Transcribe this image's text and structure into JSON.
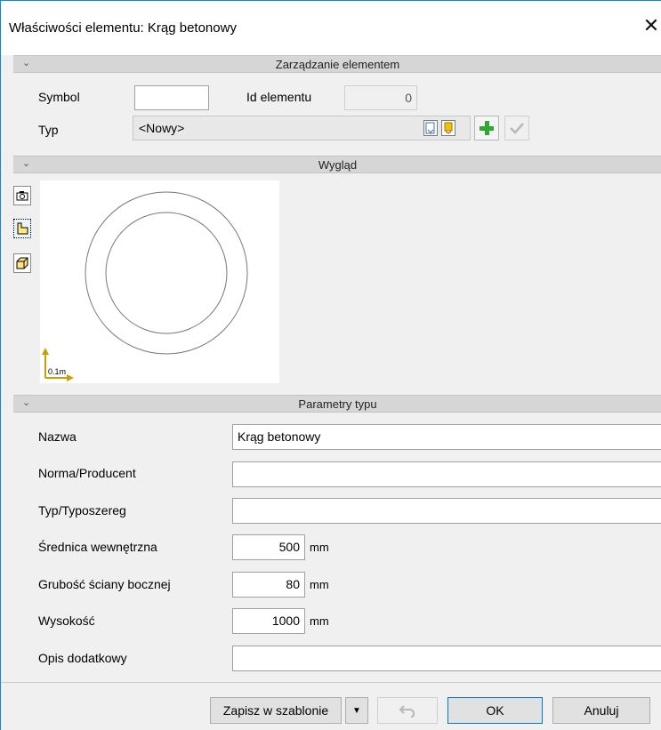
{
  "window": {
    "title": "Właściwości elementu: Krąg betonowy",
    "close_glyph": "✕"
  },
  "sections": {
    "management": {
      "label": "Zarządzanie elementem",
      "chevron": "⌄"
    },
    "appearance": {
      "label": "Wygląd",
      "chevron": "⌄"
    },
    "params": {
      "label": "Parametry typu",
      "chevron": "⌄"
    }
  },
  "management": {
    "symbol_label": "Symbol",
    "symbol_value": "",
    "id_label": "Id elementu",
    "id_value": "0",
    "typ_label": "Typ",
    "typ_value": "<Nowy>"
  },
  "preview": {
    "scale_label": "0.1m"
  },
  "params": {
    "nazwa_label": "Nazwa",
    "nazwa_value": "Krąg betonowy",
    "norma_label": "Norma/Producent",
    "norma_value": "",
    "typoszereg_label": "Typ/Typoszereg",
    "typoszereg_value": "",
    "srednica_label": "Średnica wewnętrzna",
    "srednica_value": "500",
    "srednica_unit": "mm",
    "grubosc_label": "Grubość ściany bocznej",
    "grubosc_value": "80",
    "grubosc_unit": "mm",
    "wysokosc_label": "Wysokość",
    "wysokosc_value": "1000",
    "wysokosc_unit": "mm",
    "opis_label": "Opis dodatkowy",
    "opis_value": ""
  },
  "footer": {
    "save_template_label": "Zapisz w szablonie",
    "dropdown_glyph": "▼",
    "ok_label": "OK",
    "cancel_label": "Anuluj"
  },
  "colors": {
    "accent": "#0078d7",
    "header": "#d6d6d6",
    "plus": "#2ea82e",
    "scale_arrow": "#c8a000"
  }
}
